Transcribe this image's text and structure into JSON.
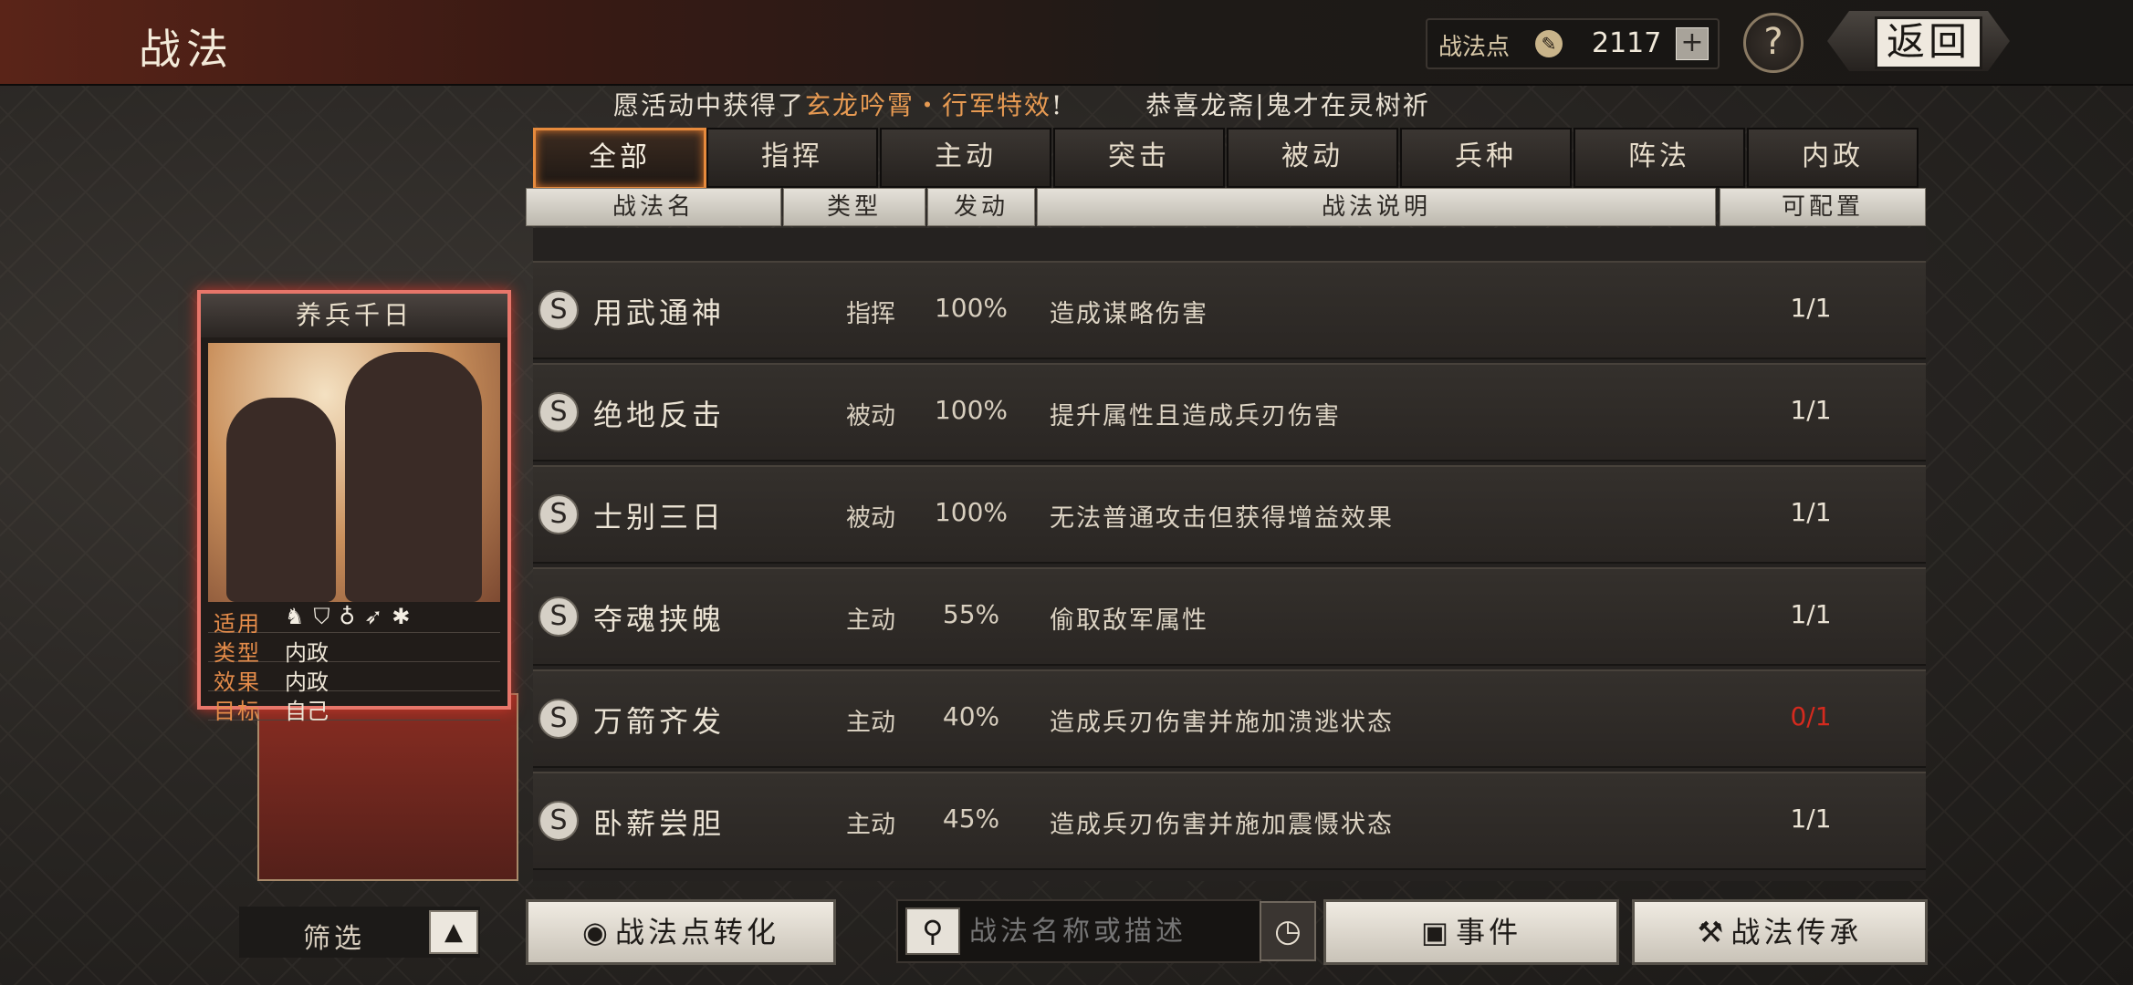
{
  "header": {
    "title": "战法",
    "points_label": "战法点",
    "points_value": "2117",
    "plus_label": "+",
    "help_label": "?",
    "back_label": "返回"
  },
  "announcement": {
    "part1": "愿活动中获得了",
    "highlight": "玄龙吟霄・行军特效",
    "part2": "!",
    "part3": "恭喜龙斋|鬼才在灵树祈"
  },
  "tabs": [
    "全部",
    "指挥",
    "主动",
    "突击",
    "被动",
    "兵种",
    "阵法",
    "内政"
  ],
  "active_tab": 0,
  "columns": {
    "name": "战法名",
    "type": "类型",
    "trigger": "发动",
    "desc": "战法说明",
    "config": "可配置"
  },
  "rows": [
    {
      "grade": "S",
      "name": "用武通神",
      "type": "指挥",
      "rate": "100%",
      "desc": "造成谋略伤害",
      "count": "1/1"
    },
    {
      "grade": "S",
      "name": "绝地反击",
      "type": "被动",
      "rate": "100%",
      "desc": "提升属性且造成兵刃伤害",
      "count": "1/1"
    },
    {
      "grade": "S",
      "name": "士别三日",
      "type": "被动",
      "rate": "100%",
      "desc": "无法普通攻击但获得增益效果",
      "count": "1/1"
    },
    {
      "grade": "S",
      "name": "夺魂挟魄",
      "type": "主动",
      "rate": "55%",
      "desc": "偷取敌军属性",
      "count": "1/1"
    },
    {
      "grade": "S",
      "name": "万箭齐发",
      "type": "主动",
      "rate": "40%",
      "desc": "造成兵刃伤害并施加溃逃状态",
      "count": "0/1"
    },
    {
      "grade": "S",
      "name": "卧薪尝胆",
      "type": "主动",
      "rate": "45%",
      "desc": "造成兵刃伤害并施加震慑状态",
      "count": "1/1"
    }
  ],
  "card": {
    "title": "养兵千日",
    "applies_label": "适用",
    "troop_icons": "♞⛉♁➶✱",
    "type_label": "类型",
    "type_value": "内政",
    "effect_label": "效果",
    "effect_value": "内政",
    "target_label": "目标",
    "target_value": "自己"
  },
  "bottom": {
    "filter_label": "筛选",
    "filter_toggle": "▲",
    "convert_icon": "◉",
    "convert_label": "战法点转化",
    "search_icon": "⚲",
    "search_placeholder": "战法名称或描述",
    "clock_icon": "◷",
    "event_icon": "▣",
    "event_label": "事件",
    "inherit_icon": "⚒",
    "inherit_label": "战法传承"
  },
  "colors": {
    "accent": "#e68a3c",
    "warn": "#d42a1e",
    "highlight": "#e79a52"
  }
}
